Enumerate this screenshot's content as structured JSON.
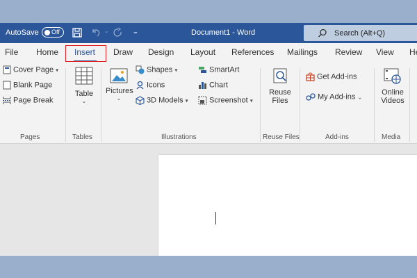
{
  "titlebar": {
    "autosave_label": "AutoSave",
    "autosave_state": "Off",
    "doc_title": "Document1  -  Word",
    "search_placeholder": "Search (Alt+Q)"
  },
  "tabs": [
    {
      "label": "File"
    },
    {
      "label": "Home"
    },
    {
      "label": "Insert",
      "active": true
    },
    {
      "label": "Draw"
    },
    {
      "label": "Design"
    },
    {
      "label": "Layout"
    },
    {
      "label": "References"
    },
    {
      "label": "Mailings"
    },
    {
      "label": "Review"
    },
    {
      "label": "View"
    },
    {
      "label": "He"
    }
  ],
  "ribbon": {
    "pages": {
      "label": "Pages",
      "items": [
        "Cover Page",
        "Blank Page",
        "Page Break"
      ]
    },
    "tables": {
      "label": "Tables",
      "table": "Table"
    },
    "illustrations": {
      "label": "Illustrations",
      "pictures": "Pictures",
      "shapes": "Shapes",
      "icons": "Icons",
      "models": "3D Models",
      "smartart": "SmartArt",
      "chart": "Chart",
      "screenshot": "Screenshot"
    },
    "reuse": {
      "label": "Reuse Files",
      "button_line1": "Reuse",
      "button_line2": "Files"
    },
    "addins": {
      "label": "Add-ins",
      "get": "Get Add-ins",
      "my": "My Add-ins"
    },
    "media": {
      "label": "Media",
      "line1": "Online",
      "line2": "Videos"
    }
  },
  "colors": {
    "brand": "#2b579a",
    "highlight": "#e02020",
    "background": "#9aafcc"
  }
}
